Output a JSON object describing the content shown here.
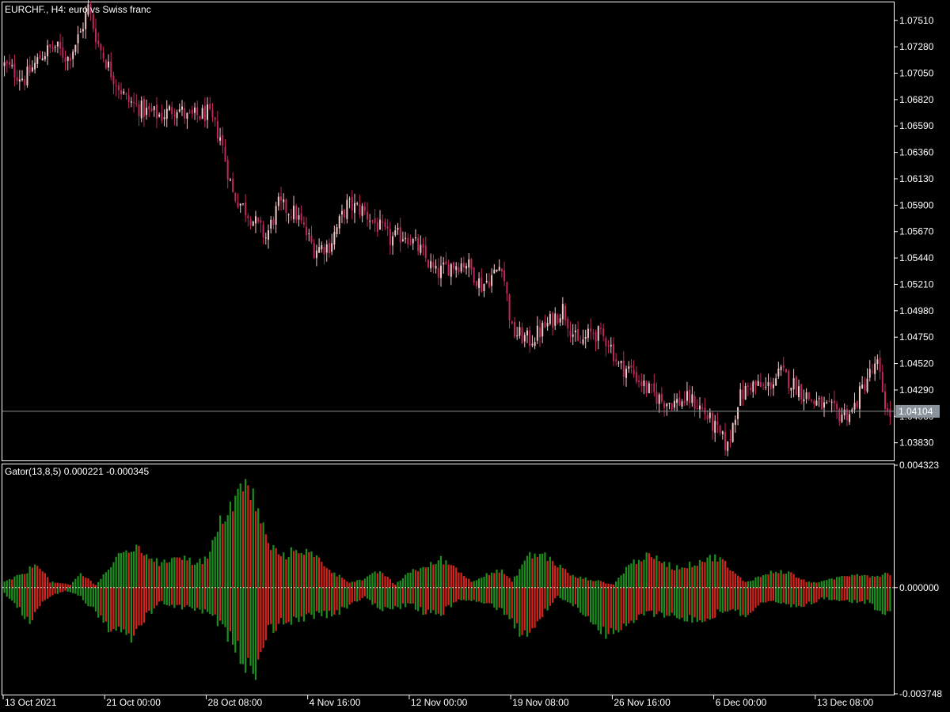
{
  "window": {
    "symbol_title": "EURCHF., H4:  euro vs Swiss franc"
  },
  "colors": {
    "background": "#000000",
    "frame": "#ffffff",
    "bull_candle": "#f4c7c7",
    "bear_candle": "#c3265f",
    "bid_line": "#8a929a",
    "bid_badge_bg": "#8a929a",
    "gator_up": "#1e8c1e",
    "gator_down": "#d0241d",
    "zero_line": "#ffffff"
  },
  "chart_data": [
    {
      "type": "candlestick",
      "title": "EURCHF., H4:  euro vs Swiss franc",
      "ylim": [
        1.0369,
        1.0766
      ],
      "y_ticks": [
        "1.07510",
        "1.07280",
        "1.07050",
        "1.06820",
        "1.06590",
        "1.06360",
        "1.06130",
        "1.05900",
        "1.05670",
        "1.05440",
        "1.05210",
        "1.04980",
        "1.04750",
        "1.04520",
        "1.04290",
        "1.04060",
        "1.03830"
      ],
      "current_price": "1.04104",
      "close_path": [
        [
          0,
          1.0712
        ],
        [
          8,
          1.07
        ],
        [
          15,
          1.0722
        ],
        [
          20,
          1.0728
        ],
        [
          25,
          1.0718
        ],
        [
          30,
          1.074
        ],
        [
          33,
          1.0762
        ],
        [
          37,
          1.073
        ],
        [
          42,
          1.0706
        ],
        [
          48,
          1.0682
        ],
        [
          55,
          1.0672
        ],
        [
          62,
          1.0668
        ],
        [
          68,
          1.0676
        ],
        [
          72,
          1.0666
        ],
        [
          80,
          1.067
        ],
        [
          85,
          1.065
        ],
        [
          90,
          1.06
        ],
        [
          96,
          1.0583
        ],
        [
          103,
          1.0562
        ],
        [
          108,
          1.059
        ],
        [
          115,
          1.0582
        ],
        [
          122,
          1.0552
        ],
        [
          128,
          1.0555
        ],
        [
          135,
          1.059
        ],
        [
          141,
          1.0586
        ],
        [
          147,
          1.0572
        ],
        [
          152,
          1.056
        ],
        [
          158,
          1.0565
        ],
        [
          164,
          1.055
        ],
        [
          170,
          1.053
        ],
        [
          176,
          1.0538
        ],
        [
          182,
          1.054
        ],
        [
          188,
          1.052
        ],
        [
          193,
          1.053
        ],
        [
          196,
          1.054
        ],
        [
          200,
          1.048
        ],
        [
          207,
          1.0472
        ],
        [
          214,
          1.0486
        ],
        [
          220,
          1.05
        ],
        [
          226,
          1.0468
        ],
        [
          232,
          1.048
        ],
        [
          238,
          1.0472
        ],
        [
          242,
          1.045
        ],
        [
          247,
          1.0446
        ],
        [
          253,
          1.043
        ],
        [
          259,
          1.042
        ],
        [
          264,
          1.0418
        ],
        [
          270,
          1.0421
        ],
        [
          275,
          1.0412
        ],
        [
          281,
          1.0392
        ],
        [
          285,
          1.0379
        ],
        [
          289,
          1.042
        ],
        [
          294,
          1.0434
        ],
        [
          300,
          1.043
        ],
        [
          306,
          1.0444
        ],
        [
          312,
          1.0432
        ],
        [
          318,
          1.042
        ],
        [
          323,
          1.0414
        ],
        [
          329,
          1.0408
        ],
        [
          334,
          1.041
        ],
        [
          340,
          1.044
        ],
        [
          344,
          1.045
        ],
        [
          348,
          1.0408
        ]
      ]
    },
    {
      "type": "bar",
      "title": "Gator(13,8,5) 0.000221 -0.000345",
      "series": [
        {
          "name": "Gator(13,8,5)",
          "values": []
        }
      ],
      "ylim": [
        -0.003748,
        0.004323
      ],
      "y_ticks": [
        "0.004323",
        "0.000000",
        "-0.003748"
      ],
      "upper_envelope": [
        [
          0,
          0.0002
        ],
        [
          8,
          0.0005
        ],
        [
          13,
          0.0009
        ],
        [
          18,
          0.0002
        ],
        [
          26,
          0.0001
        ],
        [
          30,
          0.0005
        ],
        [
          36,
          0.0001
        ],
        [
          44,
          0.001
        ],
        [
          50,
          0.0014
        ],
        [
          56,
          0.0012
        ],
        [
          62,
          0.0008
        ],
        [
          68,
          0.0012
        ],
        [
          74,
          0.0009
        ],
        [
          80,
          0.001
        ],
        [
          86,
          0.0025
        ],
        [
          95,
          0.0036
        ],
        [
          99,
          0.003
        ],
        [
          104,
          0.0015
        ],
        [
          110,
          0.0011
        ],
        [
          116,
          0.0014
        ],
        [
          124,
          0.001
        ],
        [
          130,
          0.0005
        ],
        [
          136,
          0.0002
        ],
        [
          142,
          0.0003
        ],
        [
          148,
          0.0006
        ],
        [
          154,
          0.0001
        ],
        [
          160,
          0.0006
        ],
        [
          166,
          0.0007
        ],
        [
          172,
          0.001
        ],
        [
          178,
          0.0007
        ],
        [
          184,
          0.0002
        ],
        [
          190,
          0.0005
        ],
        [
          196,
          0.0006
        ],
        [
          200,
          0.0002
        ],
        [
          206,
          0.0011
        ],
        [
          212,
          0.0012
        ],
        [
          218,
          0.0008
        ],
        [
          224,
          0.0004
        ],
        [
          230,
          0.0003
        ],
        [
          236,
          0.0002
        ],
        [
          240,
          0.0001
        ],
        [
          246,
          0.0008
        ],
        [
          252,
          0.0011
        ],
        [
          258,
          0.001
        ],
        [
          264,
          0.0007
        ],
        [
          270,
          0.0008
        ],
        [
          276,
          0.001
        ],
        [
          282,
          0.0011
        ],
        [
          286,
          0.0006
        ],
        [
          292,
          0.0002
        ],
        [
          298,
          0.0004
        ],
        [
          304,
          0.0006
        ],
        [
          310,
          0.0005
        ],
        [
          316,
          0.0002
        ],
        [
          322,
          0.0002
        ],
        [
          330,
          0.0004
        ],
        [
          336,
          0.0005
        ],
        [
          342,
          0.0004
        ],
        [
          348,
          0.0005
        ]
      ],
      "lower_envelope": [
        [
          0,
          -0.0002
        ],
        [
          6,
          -0.0008
        ],
        [
          10,
          -0.0012
        ],
        [
          16,
          -0.0004
        ],
        [
          24,
          -0.0001
        ],
        [
          30,
          -0.0003
        ],
        [
          36,
          -0.0009
        ],
        [
          42,
          -0.0015
        ],
        [
          50,
          -0.0018
        ],
        [
          56,
          -0.001
        ],
        [
          62,
          -0.0005
        ],
        [
          68,
          -0.0007
        ],
        [
          74,
          -0.0007
        ],
        [
          82,
          -0.001
        ],
        [
          90,
          -0.0019
        ],
        [
          98,
          -0.0031
        ],
        [
          104,
          -0.0015
        ],
        [
          110,
          -0.0012
        ],
        [
          118,
          -0.0011
        ],
        [
          124,
          -0.0009
        ],
        [
          130,
          -0.001
        ],
        [
          136,
          -0.0006
        ],
        [
          142,
          -0.0003
        ],
        [
          148,
          -0.0008
        ],
        [
          154,
          -0.0007
        ],
        [
          160,
          -0.0006
        ],
        [
          166,
          -0.0009
        ],
        [
          172,
          -0.0009
        ],
        [
          180,
          -0.0004
        ],
        [
          186,
          -0.0005
        ],
        [
          192,
          -0.0006
        ],
        [
          198,
          -0.0009
        ],
        [
          204,
          -0.0017
        ],
        [
          210,
          -0.0012
        ],
        [
          218,
          -0.0003
        ],
        [
          224,
          -0.0006
        ],
        [
          230,
          -0.001
        ],
        [
          236,
          -0.0016
        ],
        [
          240,
          -0.0017
        ],
        [
          246,
          -0.0013
        ],
        [
          252,
          -0.0009
        ],
        [
          258,
          -0.0009
        ],
        [
          264,
          -0.001
        ],
        [
          270,
          -0.0011
        ],
        [
          276,
          -0.0012
        ],
        [
          282,
          -0.0008
        ],
        [
          288,
          -0.0008
        ],
        [
          292,
          -0.001
        ],
        [
          298,
          -0.0006
        ],
        [
          304,
          -0.0005
        ],
        [
          310,
          -0.0007
        ],
        [
          316,
          -0.0006
        ],
        [
          322,
          -0.0004
        ],
        [
          328,
          -0.0004
        ],
        [
          334,
          -0.0005
        ],
        [
          340,
          -0.0005
        ],
        [
          346,
          -0.0009
        ],
        [
          348,
          -0.0008
        ]
      ]
    }
  ],
  "x_axis": {
    "labels": [
      {
        "text": "13 Oct 2021",
        "bar": 0
      },
      {
        "text": "21 Oct 00:00",
        "bar": 40
      },
      {
        "text": "28 Oct 08:00",
        "bar": 80
      },
      {
        "text": "4 Nov 16:00",
        "bar": 120
      },
      {
        "text": "12 Nov 00:00",
        "bar": 160
      },
      {
        "text": "19 Nov 08:00",
        "bar": 200
      },
      {
        "text": "26 Nov 16:00",
        "bar": 240
      },
      {
        "text": "6 Dec 00:00",
        "bar": 280
      },
      {
        "text": "13 Dec 08:00",
        "bar": 320
      }
    ]
  }
}
